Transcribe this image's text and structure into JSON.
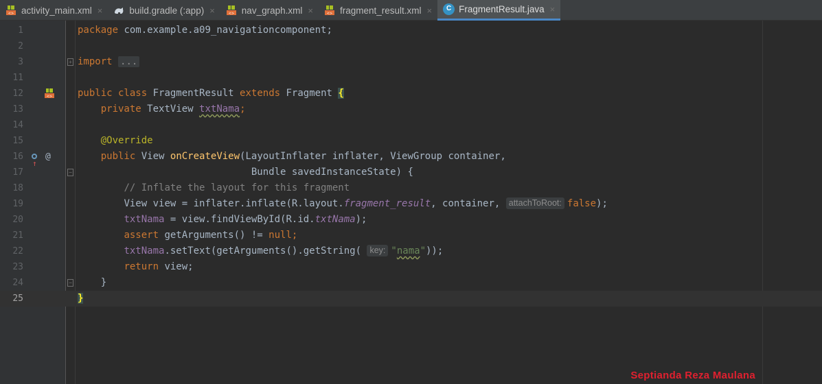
{
  "tabs": [
    {
      "label": "activity_main.xml",
      "icon": "xml-layout-icon",
      "active": false
    },
    {
      "label": "build.gradle (:app)",
      "icon": "gradle-icon",
      "active": false
    },
    {
      "label": "nav_graph.xml",
      "icon": "xml-layout-icon",
      "active": false
    },
    {
      "label": "fragment_result.xml",
      "icon": "xml-layout-icon",
      "active": false
    },
    {
      "label": "FragmentResult.java",
      "icon": "java-class-icon",
      "active": true
    }
  ],
  "java_icon_letter": "C",
  "close_glyph": "×",
  "line_numbers": [
    "1",
    "2",
    "3",
    "11",
    "12",
    "13",
    "14",
    "15",
    "16",
    "17",
    "18",
    "19",
    "20",
    "21",
    "22",
    "23",
    "24",
    "25"
  ],
  "code": {
    "package_kw": "package",
    "package_name": "com.example.a09_navigationcomponent;",
    "import_kw": "import",
    "import_folded": "...",
    "class_decl": "public class",
    "class_name": "FragmentResult",
    "extends_kw": "extends",
    "superclass": "Fragment",
    "open_brace": "{",
    "field_mod": "private",
    "field_type": "TextView",
    "field_name": "txtNama",
    "semicolon": ";",
    "annotation": "@Override",
    "method_mod": "public",
    "method_ret": "View",
    "method_name": "onCreateView",
    "method_params_1": "(LayoutInflater inflater, ViewGroup container,",
    "method_params_2": "Bundle savedInstanceState) {",
    "comment": "// Inflate the layout for this fragment",
    "l19_a": "View view = inflater.inflate(R.layout.",
    "l19_field": "fragment_result",
    "l19_b": ", container, ",
    "l19_hint": "attachToRoot:",
    "l19_false": "false",
    "l19_end": ");",
    "l20_a": "txtNama",
    "l20_b": " = view.findViewById(R.id.",
    "l20_field": "txtNama",
    "l20_end": ");",
    "l21_assert": "assert",
    "l21_b": " getArguments() != ",
    "l21_null": "null",
    "l21_end": ";",
    "l22_a": "txtNama",
    "l22_b": ".setText(getArguments().getString( ",
    "l22_hint": "key:",
    "l22_str_q1": "\"",
    "l22_str": "nama",
    "l22_str_q2": "\"",
    "l22_end": "));",
    "l23_return": "return",
    "l23_b": " view;",
    "l24_close": "}",
    "l25_close": "}"
  },
  "at_glyph": "@",
  "override_arrow": "↑",
  "watermark": "Septianda Reza Maulana",
  "colors": {
    "editor_bg": "#2b2b2b",
    "keyword": "#cc7832",
    "field": "#9876aa",
    "method": "#ffc66d",
    "string": "#6a8759",
    "comment": "#808080",
    "annotation": "#bbb529",
    "watermark": "#e0202f"
  }
}
